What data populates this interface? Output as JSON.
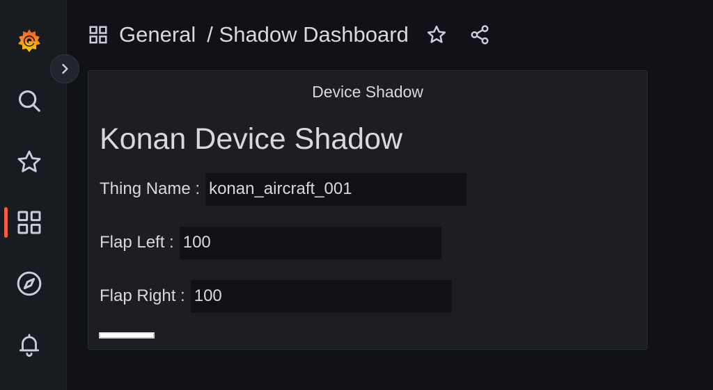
{
  "sidebar": {
    "items": [
      {
        "icon": "grafana-logo-icon"
      },
      {
        "icon": "search-icon"
      },
      {
        "icon": "star-icon"
      },
      {
        "icon": "dashboards-grid-icon",
        "active": true
      },
      {
        "icon": "compass-explore-icon"
      },
      {
        "icon": "bell-alerting-icon"
      }
    ],
    "accent_color": "#f55f3e",
    "expand_icon": "chevron-right-icon"
  },
  "breadcrumb": {
    "icon": "dashboards-grid-icon",
    "folder": "General",
    "title": "/ Shadow Dashboard",
    "actions": [
      "star-icon",
      "share-icon"
    ]
  },
  "panel": {
    "title": "Device Shadow",
    "heading": "Konan Device Shadow",
    "fields": [
      {
        "label": "Thing Name :",
        "value": "konan_aircraft_001"
      },
      {
        "label": "Flap Left :",
        "value": "100"
      },
      {
        "label": "Flap Right :",
        "value": "100"
      }
    ]
  }
}
